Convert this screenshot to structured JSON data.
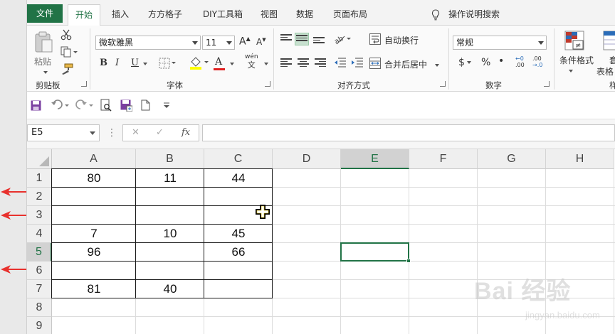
{
  "tabs": {
    "file": "文件",
    "items": [
      "开始",
      "插入",
      "方方格子",
      "DIY工具箱",
      "视图",
      "数据",
      "页面布局"
    ],
    "active_index": 0,
    "tell_me": "操作说明搜索"
  },
  "ribbon": {
    "clipboard": {
      "paste_label": "粘贴",
      "group_label": "剪贴板"
    },
    "font": {
      "font_name": "微软雅黑",
      "font_size": "11",
      "grow": "A",
      "shrink": "A",
      "bold": "B",
      "italic": "I",
      "underline": "U",
      "font_color": "A",
      "phonetic_top": "wén",
      "phonetic_bottom": "文",
      "group_label": "字体"
    },
    "alignment": {
      "wrap_text": "自动换行",
      "merge_center": "合并后居中",
      "group_label": "对齐方式"
    },
    "number": {
      "format": "常规",
      "currency": "$",
      "percent": "%",
      "comma": "•",
      "inc_decimal_top": "←0",
      "inc_decimal_bottom": ".00",
      "dec_decimal_top": ".00",
      "dec_decimal_bottom": "→.0",
      "group_label": "数字"
    },
    "styles": {
      "conditional_format": "条件格式",
      "table_format_top": "套",
      "table_format_bottom": "表格",
      "partial_label": "样"
    }
  },
  "formula_bar": {
    "name_box": "E5",
    "cancel": "✕",
    "enter": "✓",
    "fx": "fx",
    "formula": ""
  },
  "grid": {
    "columns": [
      "A",
      "B",
      "C",
      "D",
      "E",
      "F",
      "G",
      "H"
    ],
    "rows": [
      "1",
      "2",
      "3",
      "4",
      "5",
      "6",
      "7",
      "8",
      "9"
    ],
    "selected_cell": "E5",
    "cells": {
      "A1": "80",
      "B1": "11",
      "C1": "44",
      "A4": "7",
      "B4": "10",
      "C4": "45",
      "A5": "96",
      "C5": "66",
      "A7": "81",
      "B7": "40"
    }
  },
  "watermark": {
    "text": "Bai 经验",
    "sub": "jingyan.baidu.com"
  },
  "colors": {
    "excel_green": "#217346",
    "arrow_red": "#e8312d",
    "selection_green": "#217346"
  }
}
